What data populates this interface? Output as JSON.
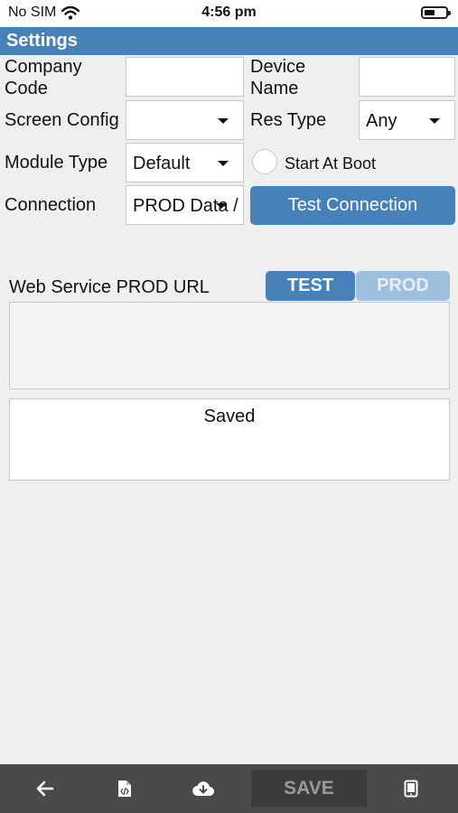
{
  "status_bar": {
    "carrier": "No SIM",
    "time": "4:56 pm"
  },
  "header": {
    "title": "Settings"
  },
  "form": {
    "company_code_label": "Company Code",
    "company_code_value": "",
    "device_name_label": "Device Name",
    "device_name_value": "",
    "screen_config_label": "Screen Config",
    "screen_config_value": "",
    "res_type_label": "Res Type",
    "res_type_value": "Any",
    "module_type_label": "Module Type",
    "module_type_value": "Default",
    "start_at_boot_label": "Start At Boot",
    "connection_label": "Connection",
    "connection_value": "PROD Data /",
    "test_connection_label": "Test Connection"
  },
  "web_service": {
    "label": "Web Service PROD URL",
    "test_label": "TEST",
    "prod_label": "PROD",
    "url_value": ""
  },
  "status_panel": {
    "message": "Saved"
  },
  "toolbar": {
    "save_label": "SAVE"
  },
  "colors": {
    "header": "#4682b9",
    "toolbar": "#4a4a4a",
    "prod_disabled": "#9ec0de"
  }
}
